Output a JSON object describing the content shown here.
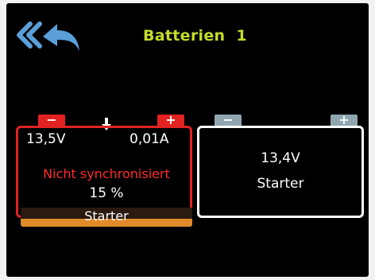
{
  "header": {
    "title": "Batterien",
    "number": "1",
    "back_icon": "back-arrow-icon"
  },
  "colors": {
    "title": "#c4dc2a",
    "selected_border": "#e32222",
    "warning_text": "#ff2a2a",
    "charge_fill": "#e08a2a",
    "normal_border": "#ffffff"
  },
  "batteries": [
    {
      "minus_label": "−",
      "plus_label": "+",
      "voltage": "13,5V",
      "current": "0,01A",
      "status": "Nicht synchronisiert",
      "percent": "15 %",
      "charge_fraction": 0.15,
      "name": "Starter",
      "selected": true
    },
    {
      "minus_label": "−",
      "plus_label": "+",
      "voltage": "13,4V",
      "name": "Starter",
      "selected": false
    }
  ]
}
